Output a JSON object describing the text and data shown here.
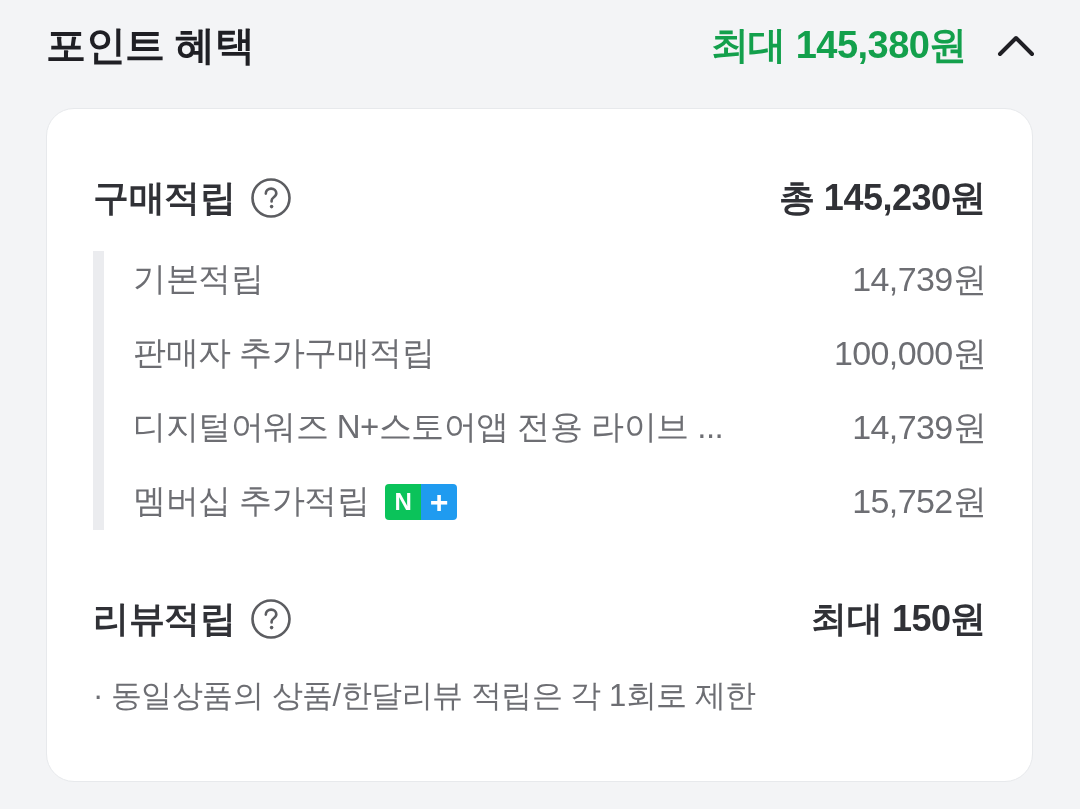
{
  "header": {
    "title": "포인트 혜택",
    "summary": "최대 145,380원",
    "expanded": true
  },
  "sections": [
    {
      "kind": "breakdown",
      "title": "구매적립",
      "total": "총 145,230원",
      "items": [
        {
          "label": "기본적립",
          "amount": "14,739원"
        },
        {
          "label": "판매자 추가구매적립",
          "amount": "100,000원"
        },
        {
          "label": "디지털어워즈 N+스토어앱 전용 라이브 ...",
          "amount": "14,739원"
        },
        {
          "label": "멤버십 추가적립",
          "amount": "15,752원",
          "badge": {
            "left": "N",
            "right": "+"
          }
        }
      ]
    },
    {
      "kind": "notes",
      "title": "리뷰적립",
      "total": "최대 150원",
      "notes": [
        "· 동일상품의 상품/한달리뷰 적립은 각 1회로 제한"
      ]
    }
  ]
}
